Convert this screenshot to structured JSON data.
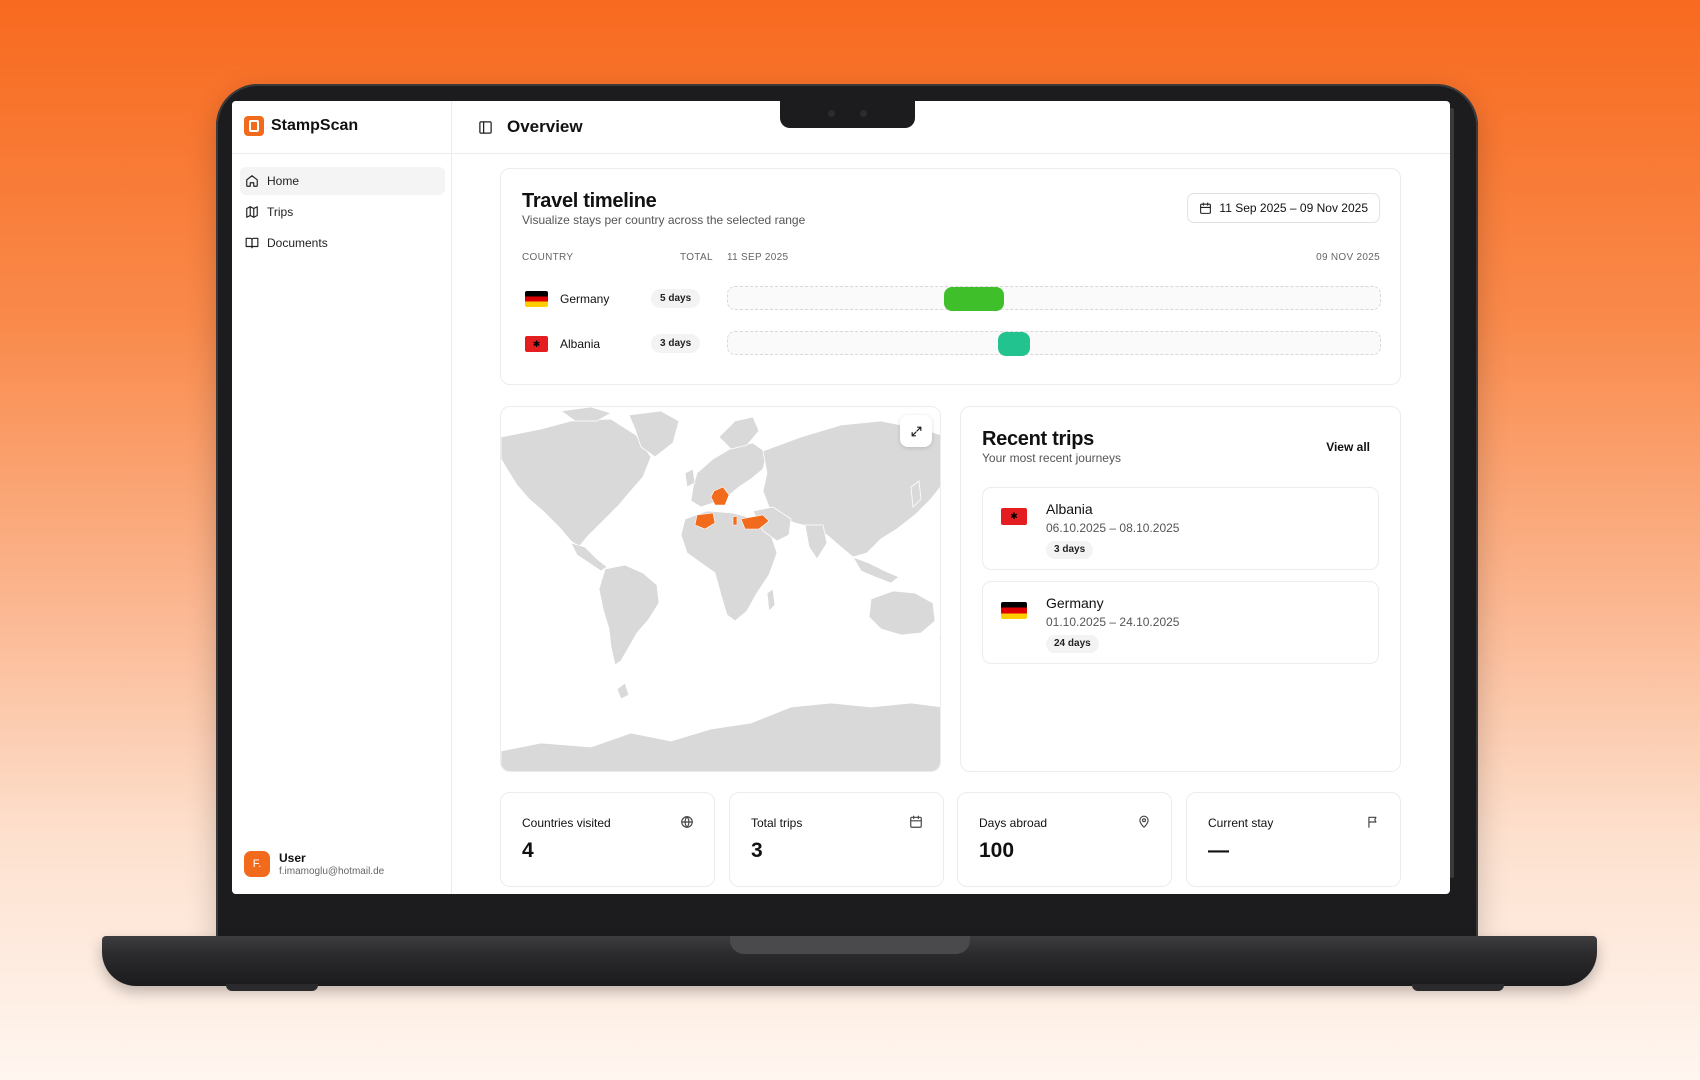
{
  "app": {
    "brand": "StampScan",
    "brand_color": "#f26a1b"
  },
  "sidebar": {
    "items": [
      {
        "label": "Home",
        "icon": "home-icon",
        "active": true
      },
      {
        "label": "Trips",
        "icon": "map-icon",
        "active": false
      },
      {
        "label": "Documents",
        "icon": "book-icon",
        "active": false
      }
    ],
    "user": {
      "avatar_initial": "F.",
      "name": "User",
      "email": "f.imamoglu@hotmail.de"
    }
  },
  "header": {
    "title": "Overview",
    "toggle_icon": "sidebar-toggle-icon"
  },
  "timeline": {
    "title": "Travel timeline",
    "subtitle": "Visualize stays per country across the selected range",
    "range_label": "11 Sep 2025 – 09 Nov 2025",
    "columns": {
      "country": "COUNTRY",
      "total": "TOTAL",
      "start": "11 SEP 2025",
      "end": "09 NOV 2025"
    },
    "rows": [
      {
        "country": "Germany",
        "total": "5 days",
        "flag": "germany-flag",
        "bar_color": "#3fbf2a"
      },
      {
        "country": "Albania",
        "total": "3 days",
        "flag": "albania-flag",
        "bar_color": "#22c38e"
      }
    ]
  },
  "map": {
    "land_color": "#d9d9d9",
    "highlight_color": "#f26a1b",
    "expand_icon": "expand-icon"
  },
  "recent_trips": {
    "title": "Recent trips",
    "subtitle": "Your most recent journeys",
    "view_all": "View all",
    "trips": [
      {
        "country": "Albania",
        "dates": "06.10.2025 – 08.10.2025",
        "duration": "3 days",
        "flag": "albania-flag"
      },
      {
        "country": "Germany",
        "dates": "01.10.2025 – 24.10.2025",
        "duration": "24 days",
        "flag": "germany-flag"
      }
    ]
  },
  "stats": [
    {
      "label": "Countries visited",
      "value": "4",
      "icon": "globe-icon"
    },
    {
      "label": "Total trips",
      "value": "3",
      "icon": "calendar-icon"
    },
    {
      "label": "Days abroad",
      "value": "100",
      "icon": "map-pin-icon"
    },
    {
      "label": "Current stay",
      "value": "—",
      "icon": "flag-icon"
    }
  ]
}
